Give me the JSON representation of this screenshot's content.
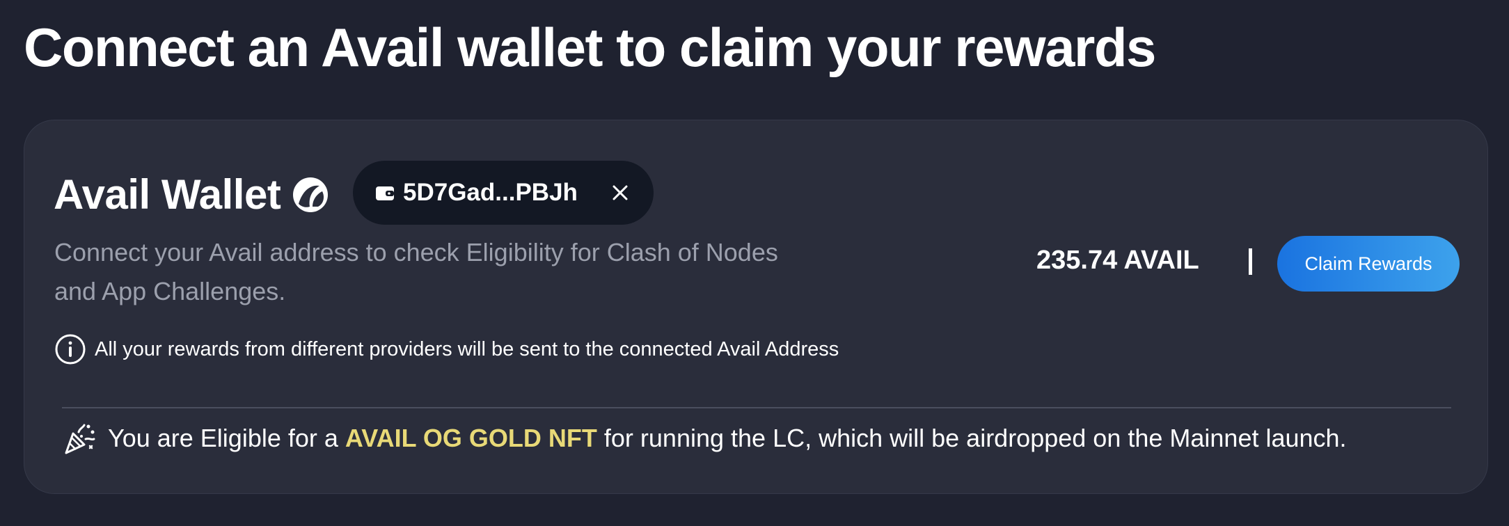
{
  "page": {
    "title": "Connect an Avail wallet to claim your rewards"
  },
  "wallet_card": {
    "title": "Avail Wallet",
    "logo_icon": "avail-logo-icon",
    "address_chip": {
      "wallet_icon": "wallet-icon",
      "address": "5D7Gad...PBJh",
      "close_icon": "close-icon"
    },
    "description": "Connect your Avail address to check Eligibility for Clash of Nodes and App Challenges.",
    "info_note": {
      "icon": "info-icon",
      "text": "All your rewards from different providers will be sent to the connected Avail Address"
    },
    "balance": "235.74 AVAIL",
    "separator": "|",
    "claim_button_label": "Claim Rewards",
    "eligibility": {
      "icon": "party-popper-icon",
      "prefix": "You are Eligible for a ",
      "highlight": "AVAIL OG GOLD NFT",
      "suffix": " for running the LC, which will be airdropped on the Mainnet launch."
    }
  },
  "colors": {
    "background": "#1f2230",
    "card": "#2a2d3b",
    "chip": "#131824",
    "button_gradient_start": "#1a73e0",
    "button_gradient_end": "#3da2ec",
    "highlight": "#e8d977",
    "muted_text": "#9ca0ad"
  }
}
